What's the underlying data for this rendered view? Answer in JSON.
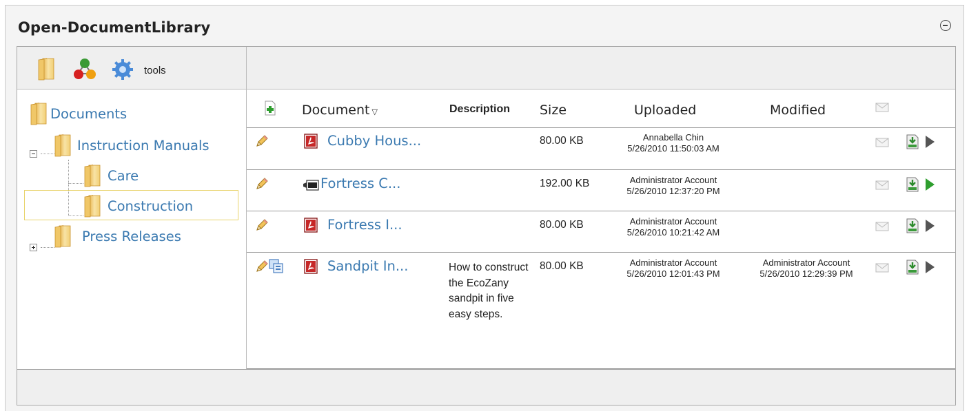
{
  "module": {
    "title": "Open-DocumentLibrary"
  },
  "toolbar": {
    "icons": [
      "folder-icon",
      "share-nodes-icon",
      "gear-icon"
    ],
    "tools_label": "tools"
  },
  "tree": {
    "root": {
      "label": "Documents"
    },
    "instruction_manuals": {
      "label": "Instruction Manuals",
      "expanded": true
    },
    "care": {
      "label": "Care"
    },
    "construction": {
      "label": "Construction",
      "selected": true
    },
    "press_releases": {
      "label": "Press Releases",
      "expanded": false
    }
  },
  "grid": {
    "headers": {
      "document": "Document",
      "description": "Description",
      "size": "Size",
      "uploaded": "Uploaded",
      "modified": "Modified"
    },
    "rows": [
      {
        "name": "Cubby Hous...",
        "file_icon": "pdf-icon",
        "description": "",
        "size": "80.00 KB",
        "uploaded_by": "Annabella Chin",
        "uploaded_at": "5/26/2010 11:50:03 AM",
        "modified_by": "",
        "modified_at": "",
        "play_color": "#555555"
      },
      {
        "name": "Fortress C...",
        "file_icon": "wmv-icon",
        "description": "",
        "size": "192.00 KB",
        "uploaded_by": "Administrator Account",
        "uploaded_at": "5/26/2010 12:37:20 PM",
        "modified_by": "",
        "modified_at": "",
        "play_color": "#2e9e2e"
      },
      {
        "name": "Fortress I...",
        "file_icon": "pdf-icon",
        "description": "",
        "size": "80.00 KB",
        "uploaded_by": "Administrator Account",
        "uploaded_at": "5/26/2010 10:21:42 AM",
        "modified_by": "",
        "modified_at": "",
        "play_color": "#555555"
      },
      {
        "name": "Sandpit In...",
        "file_icon": "pdf-icon",
        "description": "How to construct the EcoZany sandpit in five easy steps.",
        "size": "80.00 KB",
        "uploaded_by": "Administrator Account",
        "uploaded_at": "5/26/2010 12:01:43 PM",
        "modified_by": "Administrator Account",
        "modified_at": "5/26/2010 12:29:39 PM",
        "play_color": "#555555"
      }
    ]
  },
  "colors": {
    "link": "#3a79b0",
    "selection_border": "#e8d36a",
    "toolbar_bg": "#efefef"
  }
}
